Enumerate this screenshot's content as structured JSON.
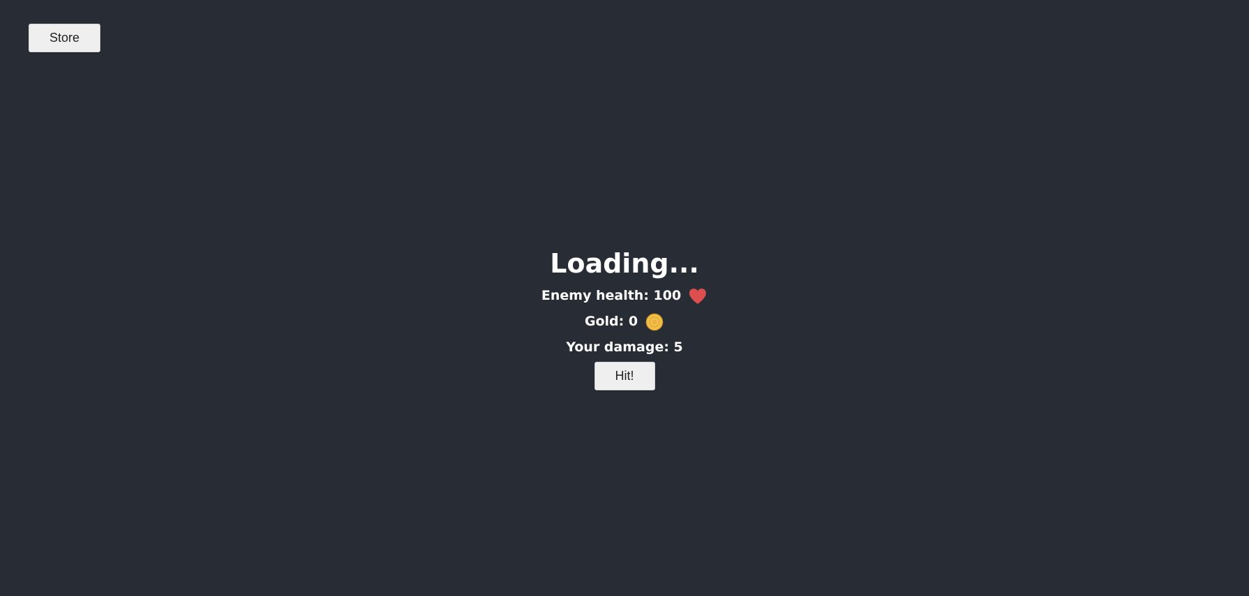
{
  "header": {
    "store_label": "Store"
  },
  "game": {
    "title": "Loading...",
    "enemy_health_label": "Enemy health: 100",
    "enemy_health_value": 100,
    "gold_label": "Gold: 0",
    "gold_value": 0,
    "damage_label": "Your damage: 5",
    "damage_value": 5,
    "hit_label": "Hit!"
  },
  "icons": {
    "heart": "heart-icon",
    "coin": "coin-icon"
  },
  "colors": {
    "background": "#282c34",
    "heart": "#dd4f4f",
    "coin": "#f4c04a",
    "text": "#ffffff",
    "button": "#efefef"
  }
}
